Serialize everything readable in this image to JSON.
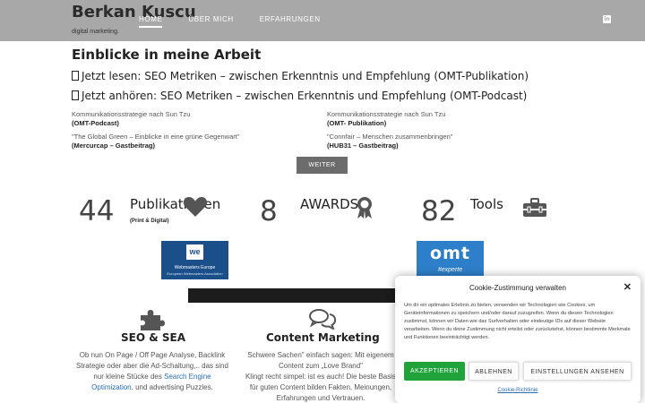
{
  "header": {
    "brand": "Berkan Kuscu",
    "nav": [
      "HOME",
      "ÜBER MICH",
      "ERFAHRUNGEN"
    ],
    "subtitle": "digital marketing."
  },
  "insights": {
    "title": "Einblicke in meine Arbeit",
    "read": "Jetzt lesen: SEO Metriken – zwischen Erkenntnis und Empfehlung (OMT-Publikation)",
    "listen": "Jetzt anhören: SEO Metriken – zwischen Erkenntnis und Empfehlung (OMT-Podcast)",
    "publications": [
      {
        "title": "Kommunikationsstrategie nach Sun Tzu",
        "source": "(OMT-Podcast)"
      },
      {
        "title": "Kommunikationsstrategie nach Sun Tzu",
        "source": "(OMT- Publikation)"
      },
      {
        "title": "\"The Global Green – Einblicke in eine grüne Gegenwart\"",
        "source": "(Mercurcap – Gastbeitrag)"
      },
      {
        "title": "\"Connfair – Menschen zusammenbringen\"",
        "source": "(HUB31 – Gastbeitrag)"
      }
    ],
    "more_button": "WEITER"
  },
  "stats": [
    {
      "number": "44",
      "label": "Publikationen",
      "sub": "(Print & Digital)",
      "icon": "heart-icon"
    },
    {
      "number": "8",
      "label": "AWARDS",
      "sub": "",
      "icon": "award-ribbon-icon"
    },
    {
      "number": "82",
      "label": "Tools",
      "sub": "",
      "icon": "toolbox-icon"
    }
  ],
  "badges": {
    "we_logo": "we",
    "we_title": "Webmasters Europe",
    "we_sub": "European Webmasters Association",
    "omt_logo": "omt",
    "omt_sub": "#experte"
  },
  "services": [
    {
      "title": "SEO & SEA",
      "icon": "puzzle-icon",
      "line1": "Ob nun On Page / Off Page Analyse, Backlink",
      "line2": "Strategie oder aber die Ad-Schaltung,.. das sind",
      "line3_a": "nur kleine Stücke des ",
      "line3_link": "Search Engine",
      "line4_link": "Optimization",
      "line4_b": ". und advertising Puzzles."
    },
    {
      "title": "Content Marketing",
      "icon": "chat-bubbles-icon",
      "line1": "Schwere Sachen\" einfach sagen: Mit eigenem",
      "line2": "Content zum „Love Brand\"",
      "line3": "Klingt recht simpel: ist es auch! Die beste Basis",
      "line4": "für guten Content bilden Fakten, Meinungen,",
      "line5": "Erfahrungen und Vertrauen."
    }
  ],
  "cookie": {
    "title": "Cookie-Zustimmung verwalten",
    "body": "Um dir ein optimales Erlebnis zu bieten, verwenden wir Technologien wie Cookies, um Geräteinformationen zu speichern und/oder darauf zuzugreifen. Wenn du diesen Technologien zustimmst, können wir Daten wie das Surfverhalten oder eindeutige IDs auf dieser Website verarbeiten. Wenn du deine Zustimmung nicht erteilst oder zurückziehst, können bestimmte Merkmale und Funktionen beeinträchtigt werden.",
    "accept": "AKZEPTIEREN",
    "reject": "ABLEHNEN",
    "settings": "EINSTELLUNGEN ANSEHEN",
    "policy": "Cookie-Richtlinie",
    "close": "✕"
  },
  "colors": {
    "header_bg": "#a8a8a8",
    "accept_green": "#1fa33a",
    "link_blue": "#2d6fb3",
    "icon_gray": "#555555"
  }
}
